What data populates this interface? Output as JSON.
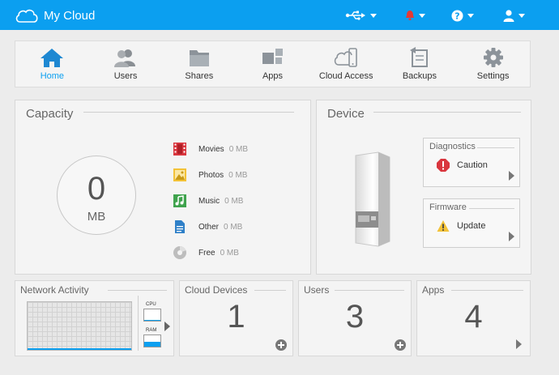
{
  "header": {
    "brand": "My Cloud"
  },
  "nav": {
    "items": [
      {
        "label": "Home"
      },
      {
        "label": "Users"
      },
      {
        "label": "Shares"
      },
      {
        "label": "Apps"
      },
      {
        "label": "Cloud Access"
      },
      {
        "label": "Backups"
      },
      {
        "label": "Settings"
      }
    ]
  },
  "capacity": {
    "title": "Capacity",
    "total_value": "0",
    "total_unit": "MB",
    "legend": [
      {
        "name": "Movies",
        "value": "0 MB",
        "color": "#d9363e"
      },
      {
        "name": "Photos",
        "value": "0 MB",
        "color": "#f3c237"
      },
      {
        "name": "Music",
        "value": "0 MB",
        "color": "#3fa34d"
      },
      {
        "name": "Other",
        "value": "0 MB",
        "color": "#2f80c8"
      },
      {
        "name": "Free",
        "value": "0 MB",
        "color": "#bdbdbd"
      }
    ]
  },
  "device": {
    "title": "Device",
    "diagnostics": {
      "title": "Diagnostics",
      "status": "Caution"
    },
    "firmware": {
      "title": "Firmware",
      "status": "Update"
    }
  },
  "network": {
    "title": "Network Activity",
    "cpu_label": "CPU",
    "ram_label": "RAM",
    "cpu_level": 0.1,
    "ram_level": 0.45
  },
  "cloud_devices": {
    "title": "Cloud Devices",
    "count": "1"
  },
  "users": {
    "title": "Users",
    "count": "3"
  },
  "apps": {
    "title": "Apps",
    "count": "4"
  },
  "colors": {
    "accent": "#0b9ff0",
    "caution": "#d9363e",
    "warning": "#f3c237"
  }
}
